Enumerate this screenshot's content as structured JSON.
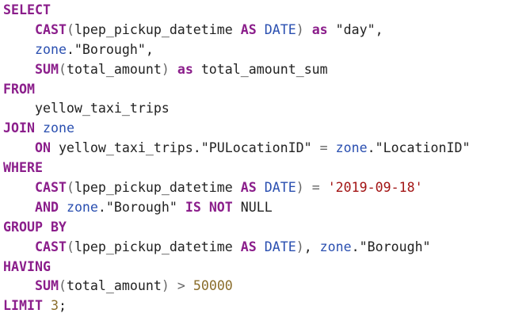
{
  "colors": {
    "plain": "#222222",
    "keyword": "#8b1e8b",
    "identifier": "#2a4fb0",
    "string": "#a31515",
    "number": "#8a6d2b",
    "operator": "#666666"
  },
  "code_lines": [
    [
      {
        "t": "SELECT",
        "k": "keyword"
      }
    ],
    [
      {
        "t": "    ",
        "k": "plain"
      },
      {
        "t": "CAST",
        "k": "keyword"
      },
      {
        "t": "(",
        "k": "operator"
      },
      {
        "t": "lpep_pickup_datetime ",
        "k": "plain"
      },
      {
        "t": "AS",
        "k": "keyword"
      },
      {
        "t": " ",
        "k": "plain"
      },
      {
        "t": "DATE",
        "k": "identifier"
      },
      {
        "t": ")",
        "k": "operator"
      },
      {
        "t": " ",
        "k": "plain"
      },
      {
        "t": "as",
        "k": "keyword"
      },
      {
        "t": " \"day\",",
        "k": "plain"
      }
    ],
    [
      {
        "t": "    ",
        "k": "plain"
      },
      {
        "t": "zone",
        "k": "identifier"
      },
      {
        "t": ".\"Borough\",",
        "k": "plain"
      }
    ],
    [
      {
        "t": "    ",
        "k": "plain"
      },
      {
        "t": "SUM",
        "k": "keyword"
      },
      {
        "t": "(",
        "k": "operator"
      },
      {
        "t": "total_amount",
        "k": "plain"
      },
      {
        "t": ")",
        "k": "operator"
      },
      {
        "t": " ",
        "k": "plain"
      },
      {
        "t": "as",
        "k": "keyword"
      },
      {
        "t": " total_amount_sum",
        "k": "plain"
      }
    ],
    [
      {
        "t": "FROM",
        "k": "keyword"
      }
    ],
    [
      {
        "t": "    yellow_taxi_trips",
        "k": "plain"
      }
    ],
    [
      {
        "t": "JOIN",
        "k": "keyword"
      },
      {
        "t": " ",
        "k": "plain"
      },
      {
        "t": "zone",
        "k": "identifier"
      }
    ],
    [
      {
        "t": "    ",
        "k": "plain"
      },
      {
        "t": "ON",
        "k": "keyword"
      },
      {
        "t": " yellow_taxi_trips.\"PULocationID\" ",
        "k": "plain"
      },
      {
        "t": "=",
        "k": "operator"
      },
      {
        "t": " ",
        "k": "plain"
      },
      {
        "t": "zone",
        "k": "identifier"
      },
      {
        "t": ".\"LocationID\"",
        "k": "plain"
      }
    ],
    [
      {
        "t": "WHERE",
        "k": "keyword"
      }
    ],
    [
      {
        "t": "    ",
        "k": "plain"
      },
      {
        "t": "CAST",
        "k": "keyword"
      },
      {
        "t": "(",
        "k": "operator"
      },
      {
        "t": "lpep_pickup_datetime ",
        "k": "plain"
      },
      {
        "t": "AS",
        "k": "keyword"
      },
      {
        "t": " ",
        "k": "plain"
      },
      {
        "t": "DATE",
        "k": "identifier"
      },
      {
        "t": ")",
        "k": "operator"
      },
      {
        "t": " ",
        "k": "plain"
      },
      {
        "t": "=",
        "k": "operator"
      },
      {
        "t": " ",
        "k": "plain"
      },
      {
        "t": "'2019-09-18'",
        "k": "string"
      }
    ],
    [
      {
        "t": "    ",
        "k": "plain"
      },
      {
        "t": "AND",
        "k": "keyword"
      },
      {
        "t": " ",
        "k": "plain"
      },
      {
        "t": "zone",
        "k": "identifier"
      },
      {
        "t": ".\"Borough\" ",
        "k": "plain"
      },
      {
        "t": "IS",
        "k": "keyword"
      },
      {
        "t": " ",
        "k": "plain"
      },
      {
        "t": "NOT",
        "k": "keyword"
      },
      {
        "t": " NULL",
        "k": "plain"
      }
    ],
    [
      {
        "t": "GROUP BY",
        "k": "keyword"
      }
    ],
    [
      {
        "t": "    ",
        "k": "plain"
      },
      {
        "t": "CAST",
        "k": "keyword"
      },
      {
        "t": "(",
        "k": "operator"
      },
      {
        "t": "lpep_pickup_datetime ",
        "k": "plain"
      },
      {
        "t": "AS",
        "k": "keyword"
      },
      {
        "t": " ",
        "k": "plain"
      },
      {
        "t": "DATE",
        "k": "identifier"
      },
      {
        "t": ")",
        "k": "operator"
      },
      {
        "t": ", ",
        "k": "plain"
      },
      {
        "t": "zone",
        "k": "identifier"
      },
      {
        "t": ".\"Borough\"",
        "k": "plain"
      }
    ],
    [
      {
        "t": "HAVING",
        "k": "keyword"
      }
    ],
    [
      {
        "t": "    ",
        "k": "plain"
      },
      {
        "t": "SUM",
        "k": "keyword"
      },
      {
        "t": "(",
        "k": "operator"
      },
      {
        "t": "total_amount",
        "k": "plain"
      },
      {
        "t": ")",
        "k": "operator"
      },
      {
        "t": " ",
        "k": "plain"
      },
      {
        "t": ">",
        "k": "operator"
      },
      {
        "t": " ",
        "k": "plain"
      },
      {
        "t": "50000",
        "k": "number"
      }
    ],
    [
      {
        "t": "LIMIT",
        "k": "keyword"
      },
      {
        "t": " ",
        "k": "plain"
      },
      {
        "t": "3",
        "k": "number"
      },
      {
        "t": ";",
        "k": "plain"
      }
    ]
  ]
}
